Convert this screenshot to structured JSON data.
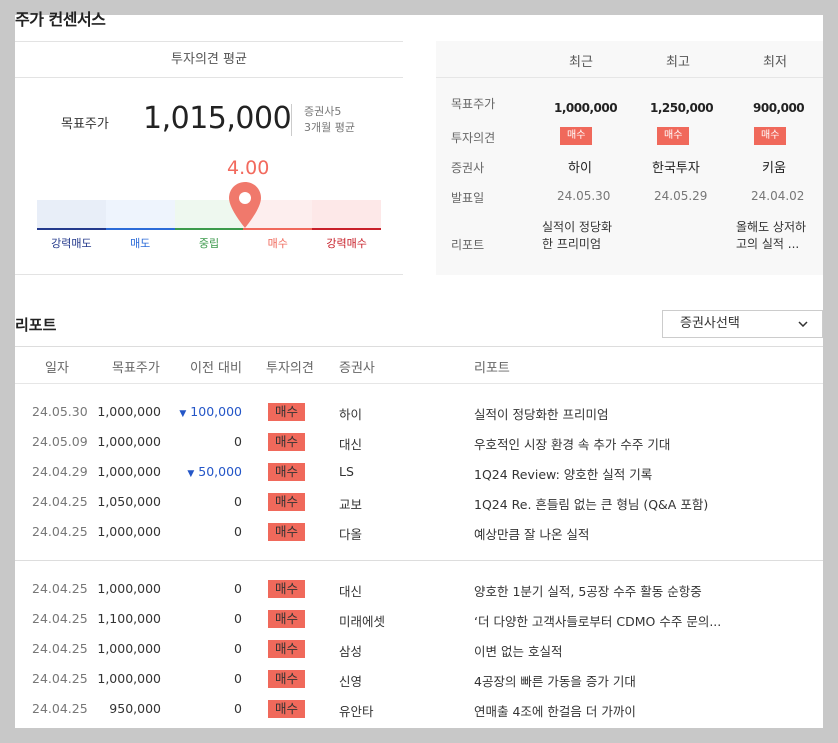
{
  "page": {
    "title": "주가 컨센서스"
  },
  "consensus": {
    "header": "투자의견 평균",
    "target_price_label": "목표주가",
    "target_price": "1,015,000",
    "meta_brokers": "증권사5",
    "meta_period": "3개월 평균",
    "score": "4.00",
    "score_value": 4.0,
    "gauge_labels": [
      "강력매도",
      "매도",
      "중립",
      "매수",
      "강력매수"
    ],
    "gauge_colors": [
      "#e8eef8",
      "#eef4fd",
      "#eef8ef",
      "#fdeeee",
      "#fde8e8"
    ],
    "gauge_bar_colors": [
      "#243a8c",
      "#2b6bd8",
      "#3c9a4c",
      "#f0695b",
      "#c8202a"
    ],
    "gauge_label_colors": [
      "#243a8c",
      "#2b6bd8",
      "#3c9a4c",
      "#f0695b",
      "#c8202a"
    ]
  },
  "summary": {
    "columns": [
      "최근",
      "최고",
      "최저"
    ],
    "row_labels": [
      "목표주가",
      "투자의견",
      "증권사",
      "발표일",
      "리포트"
    ],
    "target_prices": [
      "1,000,000",
      "1,250,000",
      "900,000"
    ],
    "opinions": [
      "매수",
      "매수",
      "매수"
    ],
    "brokers": [
      "하이",
      "한국투자",
      "키움"
    ],
    "dates": [
      "24.05.30",
      "24.05.29",
      "24.04.02"
    ],
    "reports": [
      [
        "실적이 정당화",
        "한 프리미엄"
      ],
      [
        "",
        ""
      ],
      [
        "올해도 상저하",
        "고의 실적 ..."
      ]
    ]
  },
  "reports": {
    "title": "리포트",
    "broker_select": "증권사선택",
    "headers": [
      "일자",
      "목표주가",
      "이전 대비",
      "투자의견",
      "증권사",
      "리포트"
    ],
    "rows": [
      {
        "date": "24.05.30",
        "price": "1,000,000",
        "diff": "100,000",
        "diff_up": true,
        "opinion": "매수",
        "broker": "하이",
        "report": "실적이 정당화한 프리미엄"
      },
      {
        "date": "24.05.09",
        "price": "1,000,000",
        "diff": "0",
        "diff_up": false,
        "opinion": "매수",
        "broker": "대신",
        "report": "우호적인 시장 환경 속 추가 수주 기대"
      },
      {
        "date": "24.04.29",
        "price": "1,000,000",
        "diff": "50,000",
        "diff_up": true,
        "opinion": "매수",
        "broker": "LS",
        "report": "1Q24 Review: 양호한 실적 기록"
      },
      {
        "date": "24.04.25",
        "price": "1,050,000",
        "diff": "0",
        "diff_up": false,
        "opinion": "매수",
        "broker": "교보",
        "report": "1Q24 Re. 흔들림 없는 큰 형님 (Q&A 포함)"
      },
      {
        "date": "24.04.25",
        "price": "1,000,000",
        "diff": "0",
        "diff_up": false,
        "opinion": "매수",
        "broker": "다올",
        "report": "예상만큼 잘 나온 실적"
      },
      {
        "date": "24.04.25",
        "price": "1,000,000",
        "diff": "0",
        "diff_up": false,
        "opinion": "매수",
        "broker": "대신",
        "report": "양호한 1분기 실적, 5공장 수주 활동 순항중"
      },
      {
        "date": "24.04.25",
        "price": "1,100,000",
        "diff": "0",
        "diff_up": false,
        "opinion": "매수",
        "broker": "미래에셋",
        "report": "‘더 다양한 고객사들로부터 CDMO 수주 문의..."
      },
      {
        "date": "24.04.25",
        "price": "1,000,000",
        "diff": "0",
        "diff_up": false,
        "opinion": "매수",
        "broker": "삼성",
        "report": "이변 없는 호실적"
      },
      {
        "date": "24.04.25",
        "price": "1,000,000",
        "diff": "0",
        "diff_up": false,
        "opinion": "매수",
        "broker": "신영",
        "report": "4공장의 빠른 가동을 증가 기대"
      },
      {
        "date": "24.04.25",
        "price": "950,000",
        "diff": "0",
        "diff_up": false,
        "opinion": "매수",
        "broker": "유안타",
        "report": "연매출 4조에 한걸음 더 가까이"
      }
    ]
  }
}
